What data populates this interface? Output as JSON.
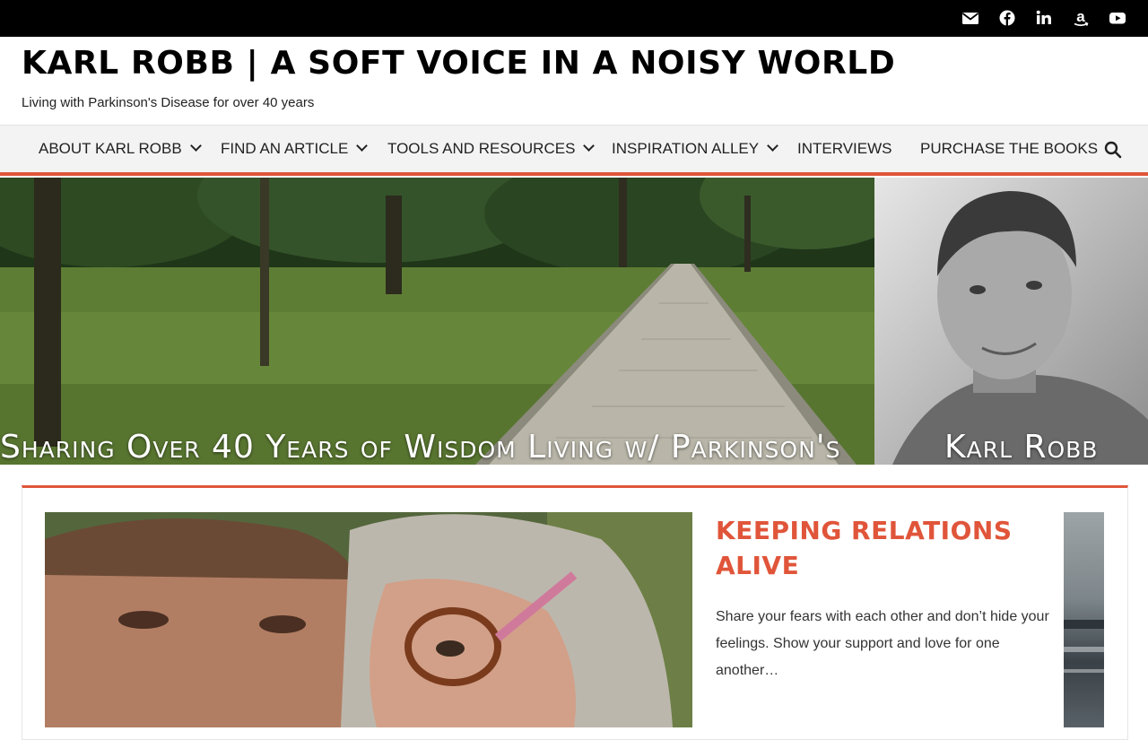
{
  "social": {
    "icons": [
      "envelope-icon",
      "facebook-icon",
      "linkedin-icon",
      "amazon-icon",
      "youtube-icon"
    ]
  },
  "header": {
    "title": "KARL ROBB | A SOFT VOICE IN A NOISY WORLD",
    "tagline": "Living with Parkinson's Disease for over 40 years"
  },
  "nav": {
    "items": [
      {
        "label": "ABOUT KARL ROBB",
        "has_dropdown": true
      },
      {
        "label": "FIND AN ARTICLE",
        "has_dropdown": true
      },
      {
        "label": "TOOLS AND RESOURCES",
        "has_dropdown": true
      },
      {
        "label": "INSPIRATION ALLEY",
        "has_dropdown": true
      },
      {
        "label": "INTERVIEWS",
        "has_dropdown": false
      },
      {
        "label": "PURCHASE THE BOOKS",
        "has_dropdown": false
      }
    ],
    "search_icon": "search-icon"
  },
  "hero": {
    "caption_left": "Sharing Over 40 Years of Wisdom Living w/ Parkinson's",
    "caption_right": "Karl Robb"
  },
  "featured": {
    "title": "KEEPING RELATIONS ALIVE",
    "excerpt": "Share your fears with each other and don’t hide your feelings. Show your support and love for one another…"
  },
  "colors": {
    "accent": "#e0553a",
    "topbar": "#000000",
    "nav_bg": "#f3f3f3"
  }
}
